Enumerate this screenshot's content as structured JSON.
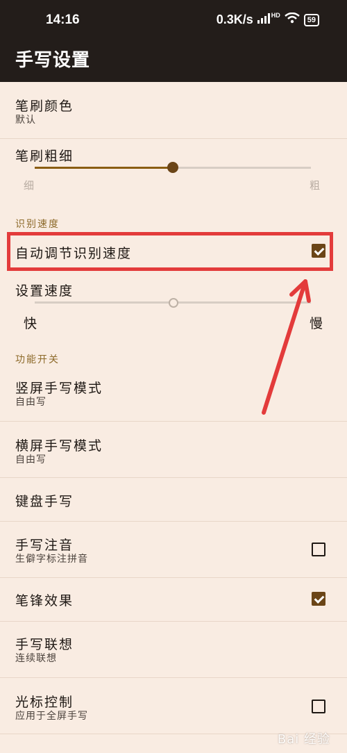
{
  "status_bar": {
    "time": "14:16",
    "speed": "0.3K/s",
    "hd": "HD",
    "battery": "59"
  },
  "header": {
    "title": "手写设置"
  },
  "brush": {
    "color": {
      "title": "笔刷颜色",
      "subtitle": "默认"
    },
    "thickness": {
      "title": "笔刷粗细",
      "min_label": "细",
      "max_label": "粗",
      "level": 0.5
    }
  },
  "speed_section": {
    "label": "识别速度",
    "auto": {
      "title": "自动调节识别速度",
      "checked": true
    },
    "set_speed": {
      "title": "设置速度",
      "min_label": "快",
      "max_label": "慢",
      "level": 0.5
    }
  },
  "function_section": {
    "label": "功能开关",
    "items": [
      {
        "title": "竖屏手写模式",
        "subtitle": "自由写"
      },
      {
        "title": "横屏手写模式",
        "subtitle": "自由写"
      },
      {
        "title": "键盘手写",
        "subtitle": ""
      },
      {
        "title": "手写注音",
        "subtitle": "生僻字标注拼音",
        "checked": false
      },
      {
        "title": "笔锋效果",
        "subtitle": "",
        "checked": true
      },
      {
        "title": "手写联想",
        "subtitle": "连续联想"
      },
      {
        "title": "光标控制",
        "subtitle": "应用于全屏手写",
        "checked": false
      }
    ]
  },
  "watermark": "Bai 经验",
  "colors": {
    "accent": "#6b4517",
    "background": "#f9ece2",
    "header": "#231d1a",
    "highlight": "#e33b3b"
  }
}
